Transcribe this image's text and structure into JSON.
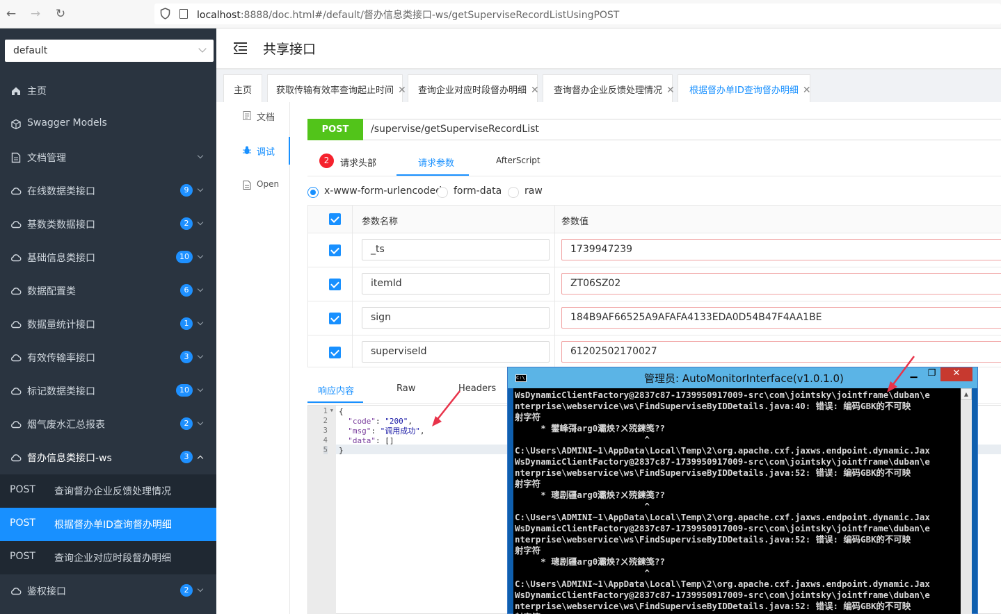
{
  "browser": {
    "url_host": "localhost",
    "url_rest": ":8888/doc.html#/default/督办信息类接口-ws/getSuperviseRecordListUsingPOST"
  },
  "sidebar": {
    "group_select": "default",
    "items": [
      {
        "label": "主页",
        "icon": "home-icon"
      },
      {
        "label": "Swagger Models",
        "icon": "cube-icon"
      },
      {
        "label": "文档管理",
        "icon": "document-icon"
      },
      {
        "label": "在线数据类接口",
        "badge": "9",
        "icon": "cloud-icon"
      },
      {
        "label": "基数类数据接口",
        "badge": "2",
        "icon": "cloud-icon"
      },
      {
        "label": "基础信息类接口",
        "badge": "10",
        "icon": "cloud-icon"
      },
      {
        "label": "数据配置类",
        "badge": "6",
        "icon": "cloud-icon"
      },
      {
        "label": "数据量统计接口",
        "badge": "1",
        "icon": "cloud-icon"
      },
      {
        "label": "有效传输率接口",
        "badge": "3",
        "icon": "cloud-icon"
      },
      {
        "label": "标记数据类接口",
        "badge": "10",
        "icon": "cloud-icon"
      },
      {
        "label": "烟气废水汇总报表",
        "badge": "2",
        "icon": "cloud-icon"
      },
      {
        "label": "督办信息类接口-ws",
        "badge": "3",
        "icon": "cloud-icon"
      }
    ],
    "subitems": [
      {
        "method": "POST",
        "label": "查询督办企业反馈处理情况"
      },
      {
        "method": "POST",
        "label": "根据督办单ID查询督办明细"
      },
      {
        "method": "POST",
        "label": "查询企业对应时段督办明细"
      }
    ],
    "last_item": {
      "label": "鉴权接口",
      "badge": "2",
      "icon": "cloud-icon"
    }
  },
  "header": {
    "title": "共享接口"
  },
  "tabs": [
    {
      "label": "主页"
    },
    {
      "label": "获取传输有效率查询起止时间",
      "close": "✕"
    },
    {
      "label": "查询企业对应时段督办明细",
      "close": "✕"
    },
    {
      "label": "查询督办企业反馈处理情况",
      "close": "✕"
    },
    {
      "label": "根据督办单ID查询督办明细",
      "close": "✕"
    }
  ],
  "vtabs": [
    {
      "label": "文档",
      "icon": "doc-icon"
    },
    {
      "label": "调试",
      "icon": "bug-icon"
    },
    {
      "label": "Open",
      "icon": "file-icon"
    }
  ],
  "request": {
    "method": "POST",
    "path": "/supervise/getSuperviseRecordList",
    "subtabs": {
      "headers_count": "2",
      "headers": "请求头部",
      "params": "请求参数",
      "after": "AfterScript"
    },
    "content_types": [
      "x-www-form-urlencoded",
      "form-data",
      "raw"
    ],
    "table_headers": {
      "name": "参数名称",
      "value": "参数值"
    },
    "params": [
      {
        "name": "_ts",
        "value": "1739947239"
      },
      {
        "name": "itemId",
        "value": "ZT06SZ02"
      },
      {
        "name": "sign",
        "value": "184B9AF66525A9AFAFA4133EDA0D54B47F4AA1BE"
      },
      {
        "name": "superviseId",
        "value": "61202502170027"
      }
    ]
  },
  "response": {
    "tabs": [
      "响应内容",
      "Raw",
      "Headers"
    ],
    "line_numbers": [
      "1",
      "2",
      "3",
      "4",
      "5"
    ],
    "code": {
      "open": "{",
      "code_key": "\"code\"",
      "code_val": "\"200\"",
      "msg_key": "\"msg\"",
      "msg_val": "\"调用成功\"",
      "data_key": "\"data\"",
      "data_val": "[]",
      "close": "}"
    }
  },
  "console": {
    "title": "管理员:  AutoMonitorInterface(v1.0.1.0)",
    "icon_text": "C:\\.",
    "buttons": {
      "min": "▁",
      "max": "❐",
      "close": "✕"
    },
    "lines": [
      "WsDynamicClientFactory@2837c87-1739950917009-src\\com\\jointsky\\jointframe\\duban\\e",
      "nterprise\\webservice\\ws\\FindSuperviseByIDDetails.java:40: 错误: 编码GBK的不可映",
      "射字符",
      "     * 鐢峰彁arg0灞炴?ㄨ殑鍊笺??",
      "                         ^",
      "C:\\Users\\ADMINI~1\\AppData\\Local\\Temp\\2\\org.apache.cxf.jaxws.endpoint.dynamic.Jax",
      "WsDynamicClientFactory@2837c87-1739950917009-src\\com\\jointsky\\jointframe\\duban\\e",
      "nterprise\\webservice\\ws\\FindSuperviseByIDDetails.java:52: 错误: 编码GBK的不可映",
      "射字符",
      "     * 璁剧疆arg0灞炴?ㄨ殑鍊笺??",
      "                         ^",
      "C:\\Users\\ADMINI~1\\AppData\\Local\\Temp\\2\\org.apache.cxf.jaxws.endpoint.dynamic.Jax",
      "WsDynamicClientFactory@2837c87-1739950917009-src\\com\\jointsky\\jointframe\\duban\\e",
      "nterprise\\webservice\\ws\\FindSuperviseByIDDetails.java:52: 错误: 编码GBK的不可映",
      "射字符",
      "     * 璁剧疆arg0灞炴?ㄨ殑鍊笺??",
      "                         ^",
      "C:\\Users\\ADMINI~1\\AppData\\Local\\Temp\\2\\org.apache.cxf.jaxws.endpoint.dynamic.Jax",
      "WsDynamicClientFactory@2837c87-1739950917009-src\\com\\jointsky\\jointframe\\duban\\e",
      "nterprise\\webservice\\ws\\FindSuperviseByIDDetails.java:52: 错误: 编码GBK的不可映",
      "射字符"
    ]
  },
  "colors": {
    "accent": "#1890ff",
    "post": "#52c41a",
    "sidebar": "#2a3440",
    "annotation": "#e8334a"
  }
}
